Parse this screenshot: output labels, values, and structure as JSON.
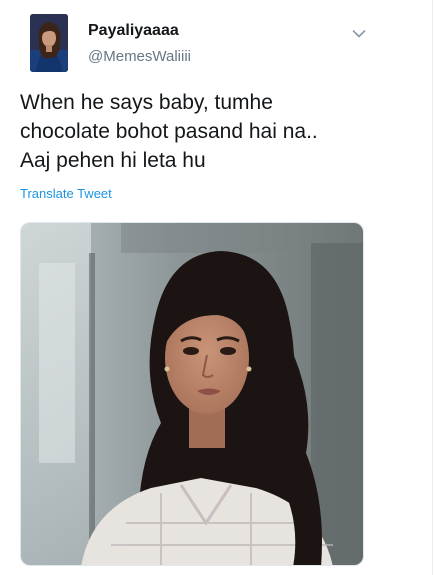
{
  "tweet": {
    "author_name": "Payaliyaaaa",
    "author_handle": "@MemesWaliiii",
    "text_lines": [
      "When he says baby, tumhe",
      "chocolate bohot pasand hai na..",
      "Aaj pehen hi leta hu"
    ],
    "translate_label": "Translate Tweet"
  },
  "icons": {
    "menu": "chevron-down-icon"
  },
  "colors": {
    "name": "#14171a",
    "handle": "#657786",
    "link": "#1b95e0",
    "chevron": "#8899a6"
  }
}
